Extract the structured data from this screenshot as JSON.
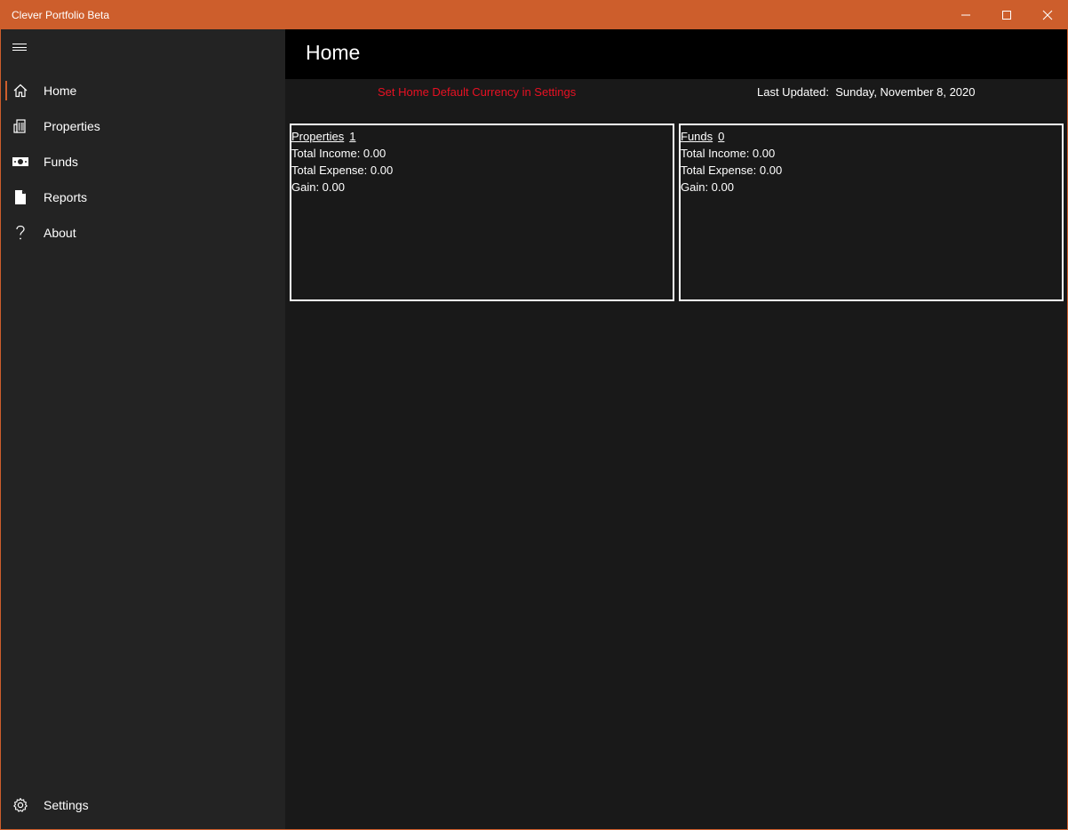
{
  "window": {
    "title": "Clever Portfolio Beta",
    "accent_color": "#cd5e2c",
    "controls": [
      "minimize-icon",
      "maximize-icon",
      "close-icon"
    ]
  },
  "sidebar": {
    "menu_icon": "hamburger-icon",
    "items": [
      {
        "label": "Home",
        "icon": "home-icon",
        "selected": true
      },
      {
        "label": "Properties",
        "icon": "building-icon",
        "selected": false
      },
      {
        "label": "Funds",
        "icon": "money-icon",
        "selected": false
      },
      {
        "label": "Reports",
        "icon": "document-icon",
        "selected": false
      },
      {
        "label": "About",
        "icon": "question-icon",
        "selected": false
      }
    ],
    "footer": {
      "label": "Settings",
      "icon": "gear-icon"
    }
  },
  "header": {
    "title": "Home"
  },
  "status": {
    "currency_warning": "Set Home Default Currency in Settings",
    "warning_color": "#e81123",
    "last_updated_label": "Last Updated:",
    "last_updated_value": "Sunday, November 8, 2020"
  },
  "cards": [
    {
      "title": "Properties",
      "count": "1",
      "total_income": "Total Income: 0.00",
      "total_expense": "Total Expense: 0.00",
      "gain": "Gain: 0.00"
    },
    {
      "title": "Funds",
      "count": "0",
      "total_income": "Total Income: 0.00",
      "total_expense": "Total Expense: 0.00",
      "gain": "Gain: 0.00"
    }
  ]
}
